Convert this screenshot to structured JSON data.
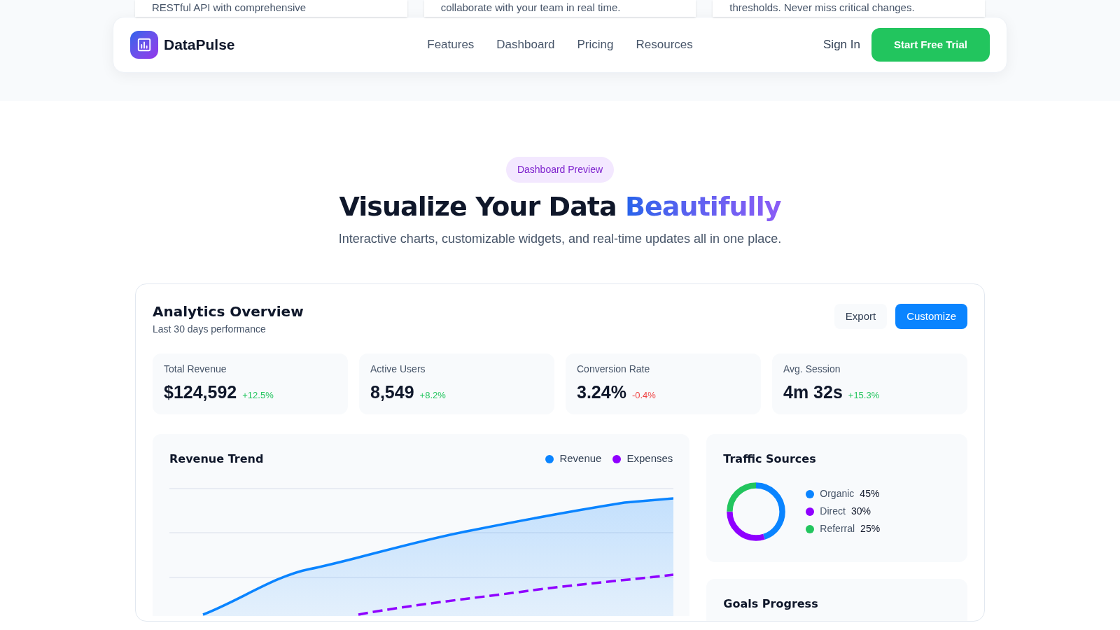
{
  "top_cards": [
    "RESTful API with comprehensive",
    "collaborate with your team in real time.",
    "thresholds. Never miss critical changes."
  ],
  "navbar": {
    "brand": "DataPulse",
    "links": [
      "Features",
      "Dashboard",
      "Pricing",
      "Resources"
    ],
    "sign_in": "Sign In",
    "cta": "Start Free Trial"
  },
  "hero": {
    "badge": "Dashboard Preview",
    "title": "Visualize Your Data",
    "title_highlight": "Beautifully",
    "subtitle": "Interactive charts, customizable widgets, and real-time updates all in one place."
  },
  "dashboard": {
    "title": "Analytics Overview",
    "subtitle": "Last 30 days performance",
    "buttons": [
      {
        "label": "Export",
        "kind": "secondary"
      },
      {
        "label": "Customize",
        "kind": "primary"
      }
    ],
    "stats": [
      {
        "label": "Total Revenue",
        "value": "$124,592",
        "change": "+12.5%",
        "negative": false
      },
      {
        "label": "Active Users",
        "value": "8,549",
        "change": "+8.2%",
        "negative": false
      },
      {
        "label": "Conversion Rate",
        "value": "3.24%",
        "change": "-0.4%",
        "negative": true
      },
      {
        "label": "Avg. Session",
        "value": "4m 32s",
        "change": "+15.3%",
        "negative": false
      }
    ],
    "revenue_trend": {
      "title": "Revenue Trend",
      "legend": [
        {
          "label": "Revenue",
          "color": "#0a84ff"
        },
        {
          "label": "Expenses",
          "color": "#8f00ff"
        }
      ]
    },
    "traffic_sources": {
      "title": "Traffic Sources",
      "items": [
        {
          "label": "Organic",
          "value": "45%",
          "color": "#0a84ff"
        },
        {
          "label": "Direct",
          "value": "30%",
          "color": "#8f00ff"
        },
        {
          "label": "Referral",
          "value": "25%",
          "color": "#22c55e"
        }
      ]
    },
    "goals_progress": {
      "title": "Goals Progress"
    }
  }
}
